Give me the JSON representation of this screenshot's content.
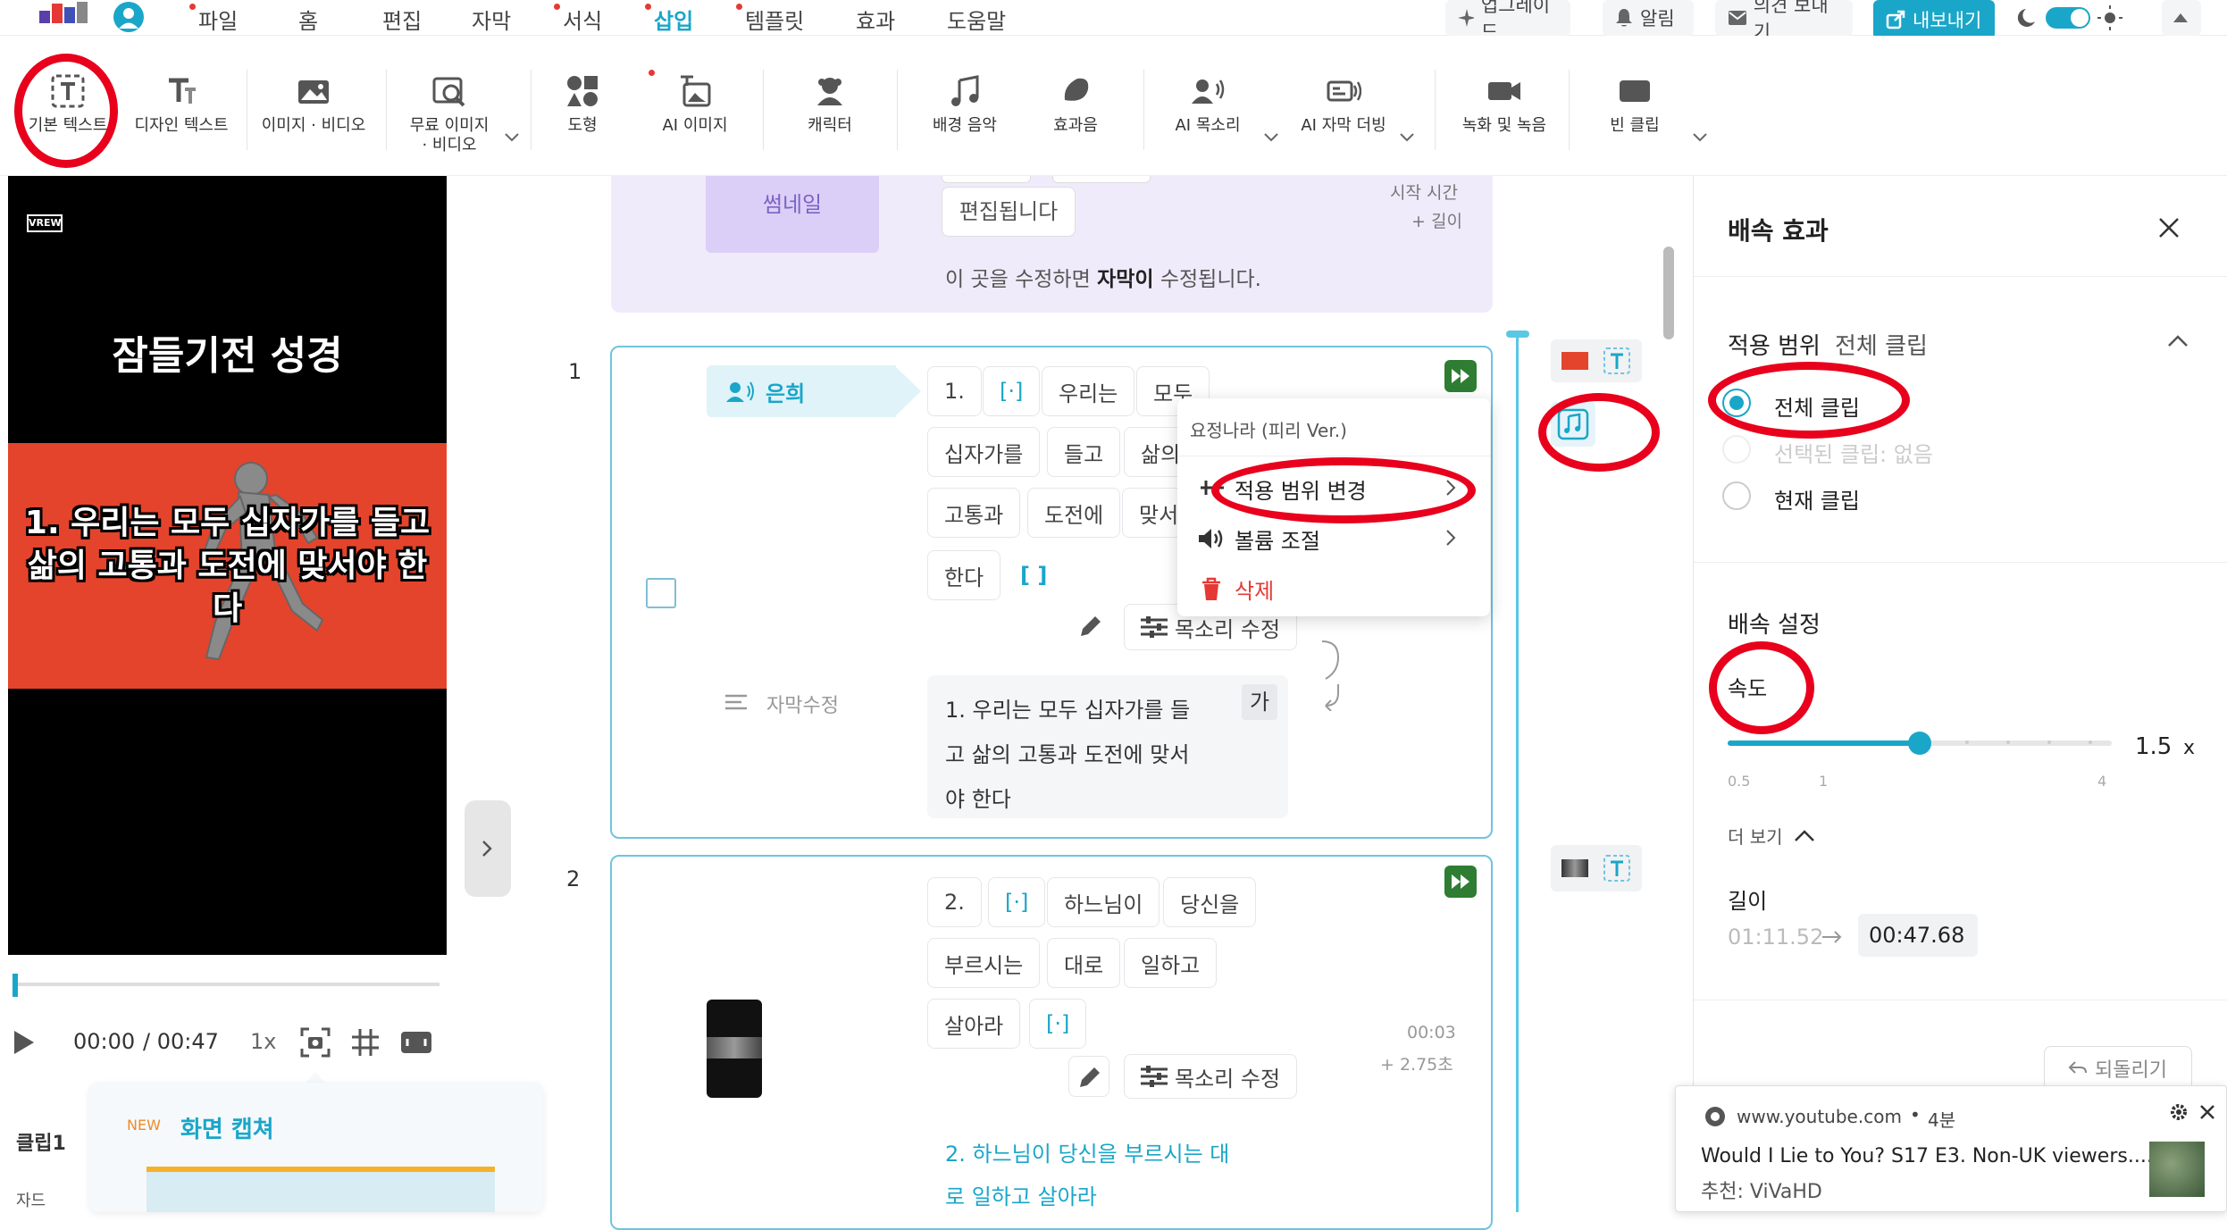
{
  "menu": {
    "items": [
      "파일",
      "홈",
      "편집",
      "자막",
      "서식",
      "삽입",
      "템플릿",
      "효과",
      "도움말"
    ],
    "active": "삽입",
    "upgrade": "업그레이드",
    "notifications": "알림",
    "feedback": "의견 보내기",
    "export": "내보내기"
  },
  "toolbar": {
    "basic_text": "기본 텍스트",
    "design_text": "디자인 텍스트",
    "image_video": "이미지 · 비디오",
    "free_media_line1": "무료 이미지",
    "free_media_line2": "· 비디오",
    "shape": "도형",
    "ai_image": "AI 이미지",
    "character": "캐릭터",
    "bgm": "배경 음악",
    "sfx": "효과음",
    "ai_voice": "AI 목소리",
    "ai_dub": "AI 자막 더빙",
    "record": "녹화 및 녹음",
    "empty_clip": "빈 클립"
  },
  "preview": {
    "logo": "VREW",
    "title": "잠들기전 성경",
    "caption_lines": [
      "1. 우리는 모두 십자가를 들고",
      "삶의 고통과 도전에 맞서야 한",
      "다"
    ],
    "time_current": "00:00",
    "time_total": "/ 00:47",
    "speed": "1x"
  },
  "capture_tip": {
    "badge": "NEW",
    "title": "화면 캡쳐"
  },
  "clip_list": {
    "label": "클립1",
    "sub": "자드"
  },
  "timeline": {
    "guide": {
      "thumbnail": "썸네일",
      "edited_chip": "편집됩니다",
      "start_time": "시작 시간",
      "length": "+ 길이",
      "hint_pre": "이 곳을 수정하면",
      "hint_bold": "자막이",
      "hint_post": "수정됩니다."
    },
    "clip1": {
      "index": "1",
      "speaker": "은희",
      "words_row1": [
        "1.",
        "[·]",
        "우리는",
        "모두"
      ],
      "words_row2": [
        "십자가를",
        "들고",
        "삶의"
      ],
      "words_row3": [
        "고통과",
        "도전에",
        "맞서"
      ],
      "words_row4": [
        "한다",
        "[ ]"
      ],
      "voice_edit": "목소리 수정",
      "subtitle_label": "자막수정",
      "subtitle_lines": [
        "1. 우리는 모두 십자가를 들",
        "고 삶의 고통과 도전에 맞서",
        "야 한다"
      ],
      "font_btn": "가"
    },
    "clip2": {
      "index": "2",
      "words_row1": [
        "2.",
        "[·]",
        "하느님이",
        "당신을"
      ],
      "words_row2": [
        "부르시는",
        "대로",
        "일하고"
      ],
      "words_row3": [
        "살아라",
        "[·]"
      ],
      "time": "00:03",
      "duration": "+ 2.75초",
      "voice_edit": "목소리 수정",
      "subtitle_lines": [
        "2. 하느님이 당신을 부르시는 대",
        "로 일하고 살아라"
      ]
    }
  },
  "context_menu": {
    "title": "요정나라 (피리 Ver.)",
    "change_scope": "적용 범위 변경",
    "volume": "볼륨 조절",
    "delete": "삭제"
  },
  "speed_panel": {
    "title": "배속 효과",
    "scope_label": "적용 범위",
    "scope_value": "전체 클립",
    "options": [
      "전체 클립",
      "선택된 클립: 없음",
      "현재 클립"
    ],
    "selected_option": 0,
    "settings_label": "배속 설정",
    "speed_label": "속도",
    "speed_value": "1.5",
    "speed_unit": "x",
    "slider_min": "0.5",
    "slider_mid": "1",
    "slider_max": "4",
    "slider_fraction": 0.5,
    "more": "더 보기",
    "length_label": "길이",
    "length_before": "01:11.52",
    "length_after": "00:47.68",
    "revert": "되돌리기"
  },
  "notification": {
    "source": "www.youtube.com",
    "time": "4분",
    "title": "Would I Lie to You? S17 E3. Non-UK viewers....",
    "channel": "추천: ViVaHD"
  },
  "colors": {
    "accent": "#1aa6c9",
    "annotation": "#e8001c",
    "guide_bg": "#f0ebfb",
    "delete": "#e53935"
  }
}
